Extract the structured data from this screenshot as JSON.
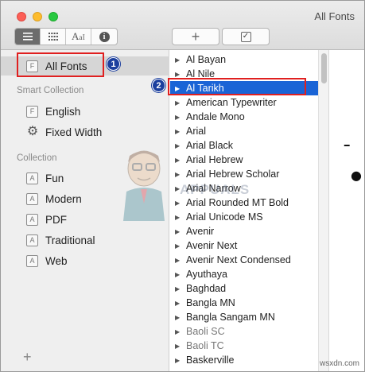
{
  "window": {
    "title": "All Fonts"
  },
  "toolbar": {
    "view_modes": [
      {
        "name": "list-view",
        "icon": "list-icon",
        "active": true
      },
      {
        "name": "grid-view",
        "icon": "grid-icon",
        "active": false
      },
      {
        "name": "sample-view",
        "icon": "font-sample-icon",
        "label_big": "A",
        "label_small": "a",
        "label_mid": "I",
        "active": false
      },
      {
        "name": "info-view",
        "icon": "info-icon",
        "label": "i",
        "active": false
      }
    ],
    "add_label": "+",
    "validate_label": "✓"
  },
  "sidebar": {
    "top_items": [
      {
        "label": "All Fonts",
        "icon": "F",
        "selected": true
      }
    ],
    "smart_collection_header": "Smart Collection",
    "smart_items": [
      {
        "label": "English",
        "icon": "F"
      },
      {
        "label": "Fixed Width",
        "icon": "gear"
      }
    ],
    "collection_header": "Collection",
    "collection_items": [
      {
        "label": "Fun",
        "icon": "A"
      },
      {
        "label": "Modern",
        "icon": "A"
      },
      {
        "label": "PDF",
        "icon": "A"
      },
      {
        "label": "Traditional",
        "icon": "A"
      },
      {
        "label": "Web",
        "icon": "A"
      }
    ],
    "add_label": "+"
  },
  "font_list": {
    "items": [
      {
        "label": "Al Bayan"
      },
      {
        "label": "Al Nile"
      },
      {
        "label": "Al Tarikh",
        "selected": true
      },
      {
        "label": "American Typewriter"
      },
      {
        "label": "Andale Mono"
      },
      {
        "label": "Arial"
      },
      {
        "label": "Arial Black"
      },
      {
        "label": "Arial Hebrew"
      },
      {
        "label": "Arial Hebrew Scholar"
      },
      {
        "label": "Arial Narrow"
      },
      {
        "label": "Arial Rounded MT Bold"
      },
      {
        "label": "Arial Unicode MS"
      },
      {
        "label": "Avenir"
      },
      {
        "label": "Avenir Next"
      },
      {
        "label": "Avenir Next Condensed"
      },
      {
        "label": "Ayuthaya"
      },
      {
        "label": "Baghdad"
      },
      {
        "label": "Bangla MN"
      },
      {
        "label": "Bangla Sangam MN"
      },
      {
        "label": "Baoli SC"
      },
      {
        "label": "Baoli TC"
      },
      {
        "label": "Baskerville"
      }
    ]
  },
  "annotations": {
    "badge_1": "1",
    "badge_2": "2",
    "box_color": "#e02020",
    "badge_color": "#1c3f9e"
  },
  "watermark": {
    "brand": "APPUALS",
    "site": "wsxdn.com"
  },
  "colors": {
    "selection_blue": "#1a64d6",
    "sidebar_bg": "#efefef"
  }
}
